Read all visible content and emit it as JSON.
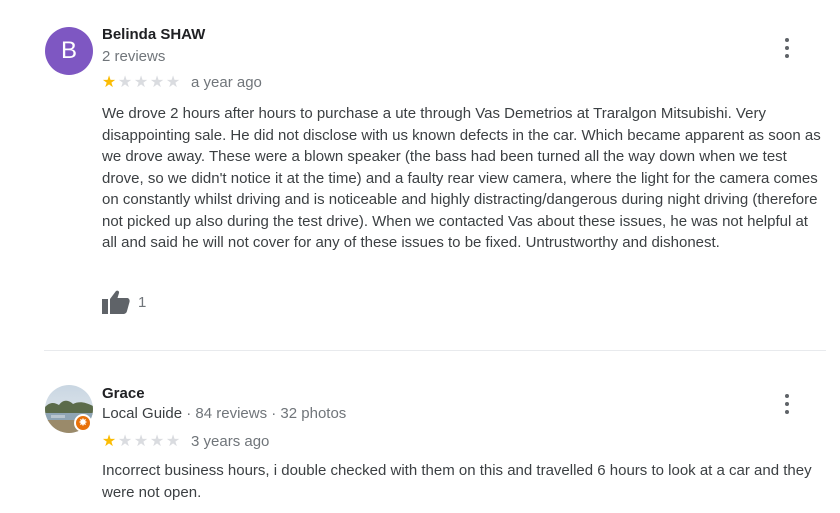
{
  "reviews": [
    {
      "avatar_letter": "B",
      "avatar_color": "#7e57c2",
      "name": "Belinda SHAW",
      "meta": "2 reviews",
      "rating": 1,
      "max_rating": 5,
      "date": "a year ago",
      "text": "We drove 2 hours after hours to purchase a ute through Vas Demetrios at Traralgon Mitsubishi. Very disappointing sale. He did not disclose with us known defects in the car. Which became apparent as soon as we drove away. These were a blown speaker (the bass had been turned all the way down when we test drove, so we didn't notice it at the time) and a faulty rear view camera, where the light for the camera comes on constantly whilst driving and is noticeable and highly distracting/dangerous during night driving (therefore not picked up also during the test drive). When we contacted Vas about these issues, he was not helpful at all and said he will not cover for any of these issues to be fixed. Untrustworthy and dishonest.",
      "likes": "1",
      "like_icon": "thumbs-up-icon"
    },
    {
      "name": "Grace",
      "guide_label": "Local Guide",
      "meta": " · 84 reviews · 32 photos",
      "badge_icon": "local-guide-star-icon",
      "badge_color": "#e8710a",
      "rating": 1,
      "max_rating": 5,
      "date": "3 years ago",
      "text": "Incorrect business hours,  i double checked with them on this and travelled 6 hours to look at a car and they were not open."
    }
  ],
  "colors": {
    "star_on": "#fbbc04",
    "star_off": "#dadce0",
    "secondary_text": "#70757a"
  }
}
